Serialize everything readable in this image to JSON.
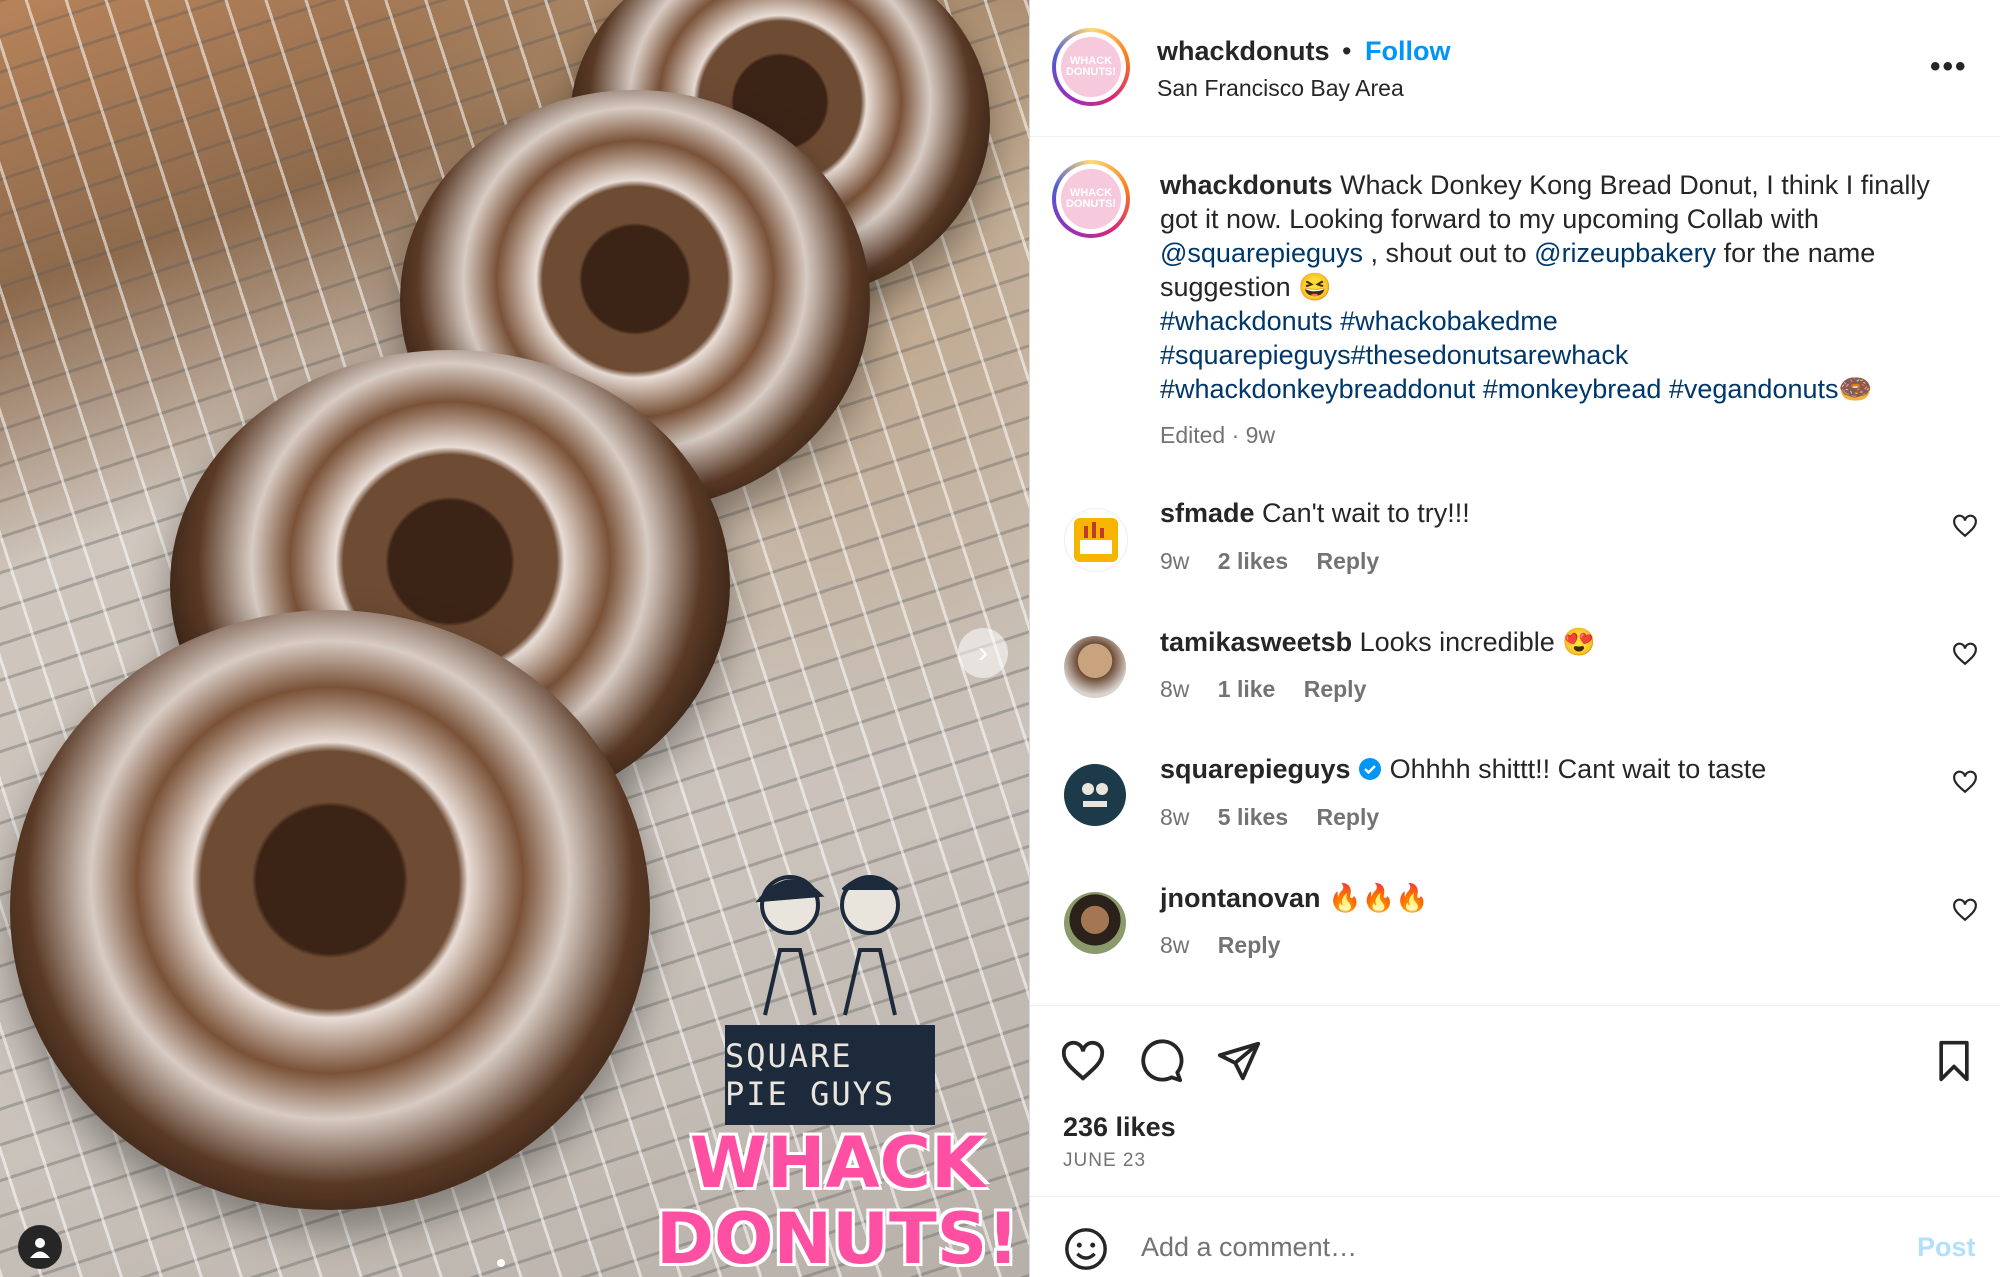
{
  "post": {
    "username": "whackdonuts",
    "separator": "•",
    "follow_label": "Follow",
    "location": "San Francisco Bay Area",
    "more_label": "•••",
    "avatar_text": "WHACK DONUTS!"
  },
  "photo": {
    "sponsor_logo_text": "SQUARE PIE GUYS",
    "brand_logo_line1": "WHACK",
    "brand_logo_line2": "DONUTS!",
    "next_arrow": "›"
  },
  "caption": {
    "username": "whackdonuts",
    "text1": " Whack Donkey Kong Bread Donut, I think I finally got it now. Looking forward to my upcoming Collab with ",
    "mention1": "@squarepieguys",
    "text2": " , shout out to ",
    "mention2": "@rizeupbakery",
    "text3": " for the name suggestion 😆",
    "hashtags_line1": "#whackdonuts #whackobakedme",
    "hashtags_line2": "#squarepieguys#thesedonutsarewhack",
    "hashtags_line3": "#whackdonkeybreaddonut #monkeybread #vegandonuts🍩",
    "edited_meta": "Edited · 9w"
  },
  "comments": [
    {
      "username": "sfmade",
      "text": " Can't wait to try!!!",
      "age": "9w",
      "likes": "2 likes",
      "reply": "Reply",
      "verified": false
    },
    {
      "username": "tamikasweetsb",
      "text": " Looks incredible 😍",
      "age": "8w",
      "likes": "1 like",
      "reply": "Reply",
      "verified": false
    },
    {
      "username": "squarepieguys",
      "text": " Ohhhh shittt!! Cant wait to taste",
      "age": "8w",
      "likes": "5 likes",
      "reply": "Reply",
      "verified": true
    },
    {
      "username": "jnontanovan",
      "text": " 🔥🔥🔥",
      "age": "8w",
      "likes": "",
      "reply": "Reply",
      "verified": false
    }
  ],
  "engagement": {
    "likes": "236 likes",
    "date": "JUNE 23"
  },
  "composer": {
    "placeholder": "Add a comment…",
    "post_label": "Post"
  },
  "colors": {
    "link": "#00376b",
    "follow": "#0095f6",
    "post_disabled": "#b2dffc",
    "verified": "#0095f6"
  }
}
